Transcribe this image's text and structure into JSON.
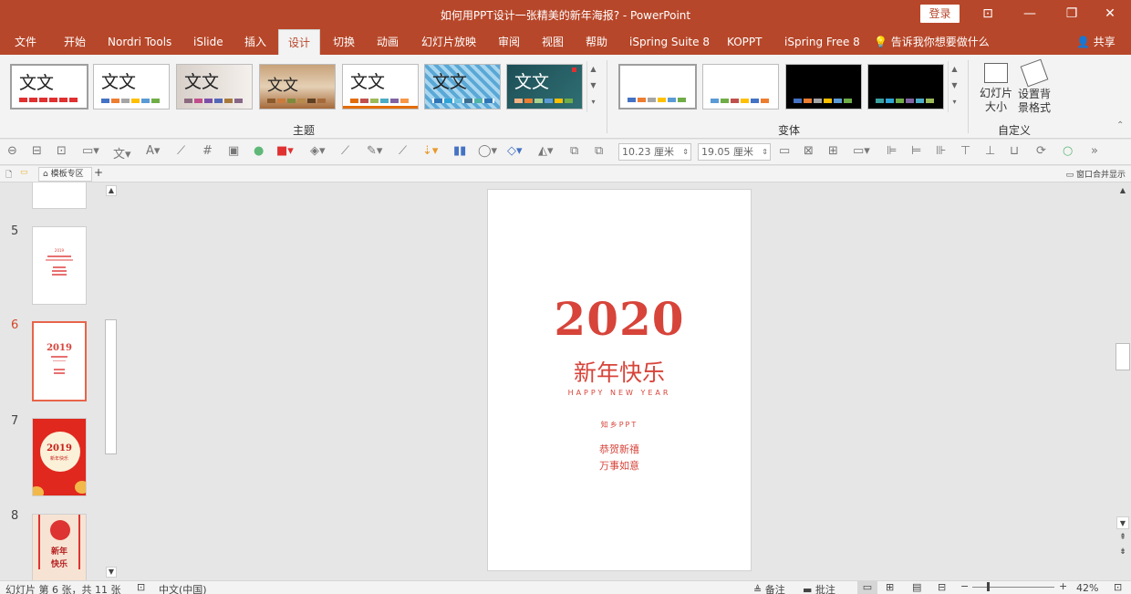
{
  "window": {
    "title": "如何用PPT设计一张精美的新年海报? - PowerPoint",
    "login": "登录"
  },
  "tabs": [
    "文件",
    "开始",
    "Nordri Tools",
    "iSlide",
    "插入",
    "设计",
    "切换",
    "动画",
    "幻灯片放映",
    "审阅",
    "视图",
    "帮助",
    "iSpring Suite 8",
    "KOPPT",
    "iSpring Free 8"
  ],
  "active_tab": "设计",
  "tell_me": "告诉我你想要做什么",
  "share": "共享",
  "ribbon": {
    "theme_glyph": "文文",
    "theme_label": "主题",
    "variant_label": "变体",
    "custom_label": "自定义",
    "slide_size": "幻灯片\n大小",
    "format_bg": "设置背\n景格式"
  },
  "toolbar": {
    "width": "10.23 厘米",
    "height": "19.05 厘米"
  },
  "docbar": {
    "tab": "模板专区",
    "right": "窗口合并显示"
  },
  "thumbs": {
    "n5": "5",
    "n6": "6",
    "n7": "7",
    "n8": "8",
    "t5_year": "2019",
    "t6_year": "2019",
    "t7_year": "2019",
    "t7_text": "新年快乐",
    "t8_a": "新年",
    "t8_b": "快乐"
  },
  "slide": {
    "year": "2020",
    "headline": "新年快乐",
    "english": "HAPPY NEW YEAR",
    "brand": "知乡PPT",
    "line1": "恭贺新禧",
    "line2": "万事如意"
  },
  "status": {
    "slide_info": "幻灯片 第 6 张，共 11 张",
    "language": "中文(中国)",
    "notes": "备注",
    "comments": "批注",
    "zoom": "42%"
  },
  "colors": {
    "accent": "#b7472a",
    "slide_red": "#d7443a"
  }
}
